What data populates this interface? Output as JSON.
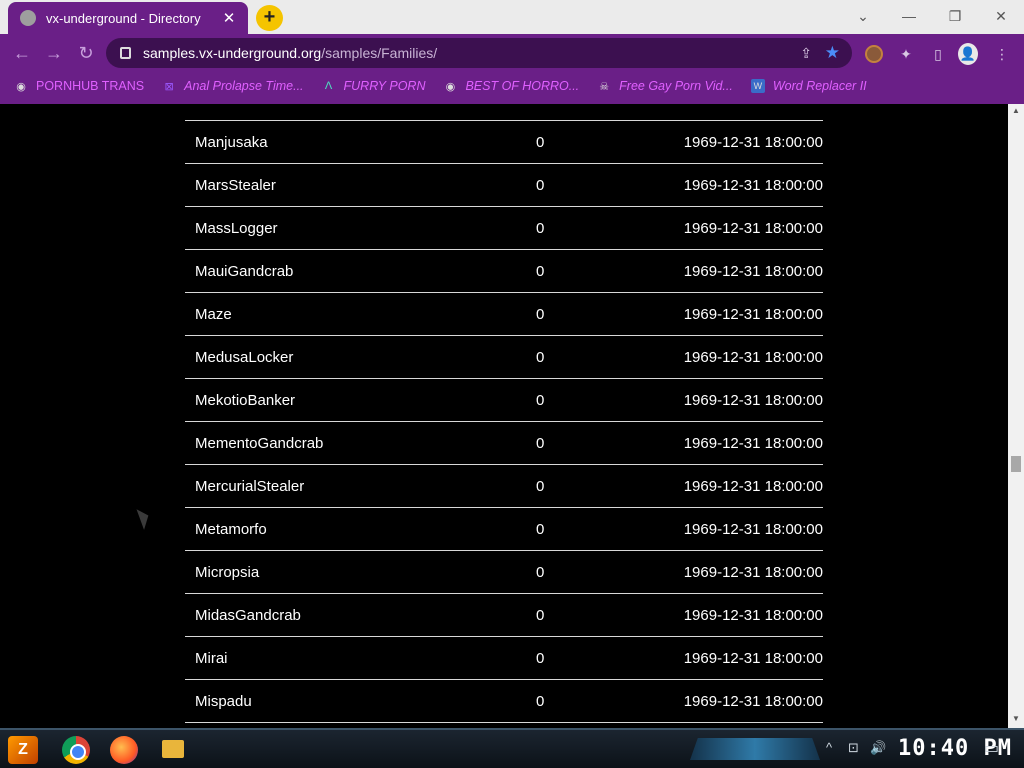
{
  "tab": {
    "title": "vx-underground - Directory",
    "close": "✕",
    "new_tab": "+"
  },
  "window": {
    "minimize": "—",
    "restore": "❐",
    "close": "✕",
    "tab_search": "⌄"
  },
  "toolbar": {
    "back": "←",
    "forward": "→",
    "reload": "↻",
    "url_host": "samples.vx-underground.org",
    "url_path": "/samples/Families/",
    "share": "⇪",
    "star": "★",
    "extensions": "✦",
    "sidepanel": "▯",
    "profile": "👤",
    "menu": "⋮"
  },
  "bookmarks": [
    {
      "label": "PORNHUB TRANS",
      "icon": "globe-icon",
      "glyph": "◉"
    },
    {
      "label": "Anal Prolapse Time...",
      "icon": "bookmark-icon",
      "glyph": "⊠"
    },
    {
      "label": "FURRY PORN",
      "icon": "a-logo-icon",
      "glyph": "Λ"
    },
    {
      "label": "BEST OF HORRO...",
      "icon": "globe-icon",
      "glyph": "◉"
    },
    {
      "label": "Free Gay Porn Vid...",
      "icon": "skull-icon",
      "glyph": "☠"
    },
    {
      "label": "Word Replacer II",
      "icon": "wr-icon",
      "glyph": "W"
    }
  ],
  "listing": {
    "rows": [
      {
        "name": "Manjusaka",
        "size": "0",
        "date": "1969-12-31 18:00:00"
      },
      {
        "name": "MarsStealer",
        "size": "0",
        "date": "1969-12-31 18:00:00"
      },
      {
        "name": "MassLogger",
        "size": "0",
        "date": "1969-12-31 18:00:00"
      },
      {
        "name": "MauiGandcrab",
        "size": "0",
        "date": "1969-12-31 18:00:00"
      },
      {
        "name": "Maze",
        "size": "0",
        "date": "1969-12-31 18:00:00"
      },
      {
        "name": "MedusaLocker",
        "size": "0",
        "date": "1969-12-31 18:00:00"
      },
      {
        "name": "MekotioBanker",
        "size": "0",
        "date": "1969-12-31 18:00:00"
      },
      {
        "name": "MementoGandcrab",
        "size": "0",
        "date": "1969-12-31 18:00:00"
      },
      {
        "name": "MercurialStealer",
        "size": "0",
        "date": "1969-12-31 18:00:00"
      },
      {
        "name": "Metamorfo",
        "size": "0",
        "date": "1969-12-31 18:00:00"
      },
      {
        "name": "Micropsia",
        "size": "0",
        "date": "1969-12-31 18:00:00"
      },
      {
        "name": "MidasGandcrab",
        "size": "0",
        "date": "1969-12-31 18:00:00"
      },
      {
        "name": "Mirai",
        "size": "0",
        "date": "1969-12-31 18:00:00"
      },
      {
        "name": "Mispadu",
        "size": "0",
        "date": "1969-12-31 18:00:00"
      }
    ]
  },
  "taskbar": {
    "start": "Z",
    "clock": "10:40 PM",
    "tray": {
      "chevron": "^",
      "network": "⊡",
      "volume": "🔊",
      "notifications": "▭"
    }
  },
  "colors": {
    "chrome_bg": "#6a1f87",
    "bookmark_text": "#e060ff",
    "star": "#4b8df8",
    "page_bg": "#000000",
    "row_divider": "#d8d8d8"
  }
}
